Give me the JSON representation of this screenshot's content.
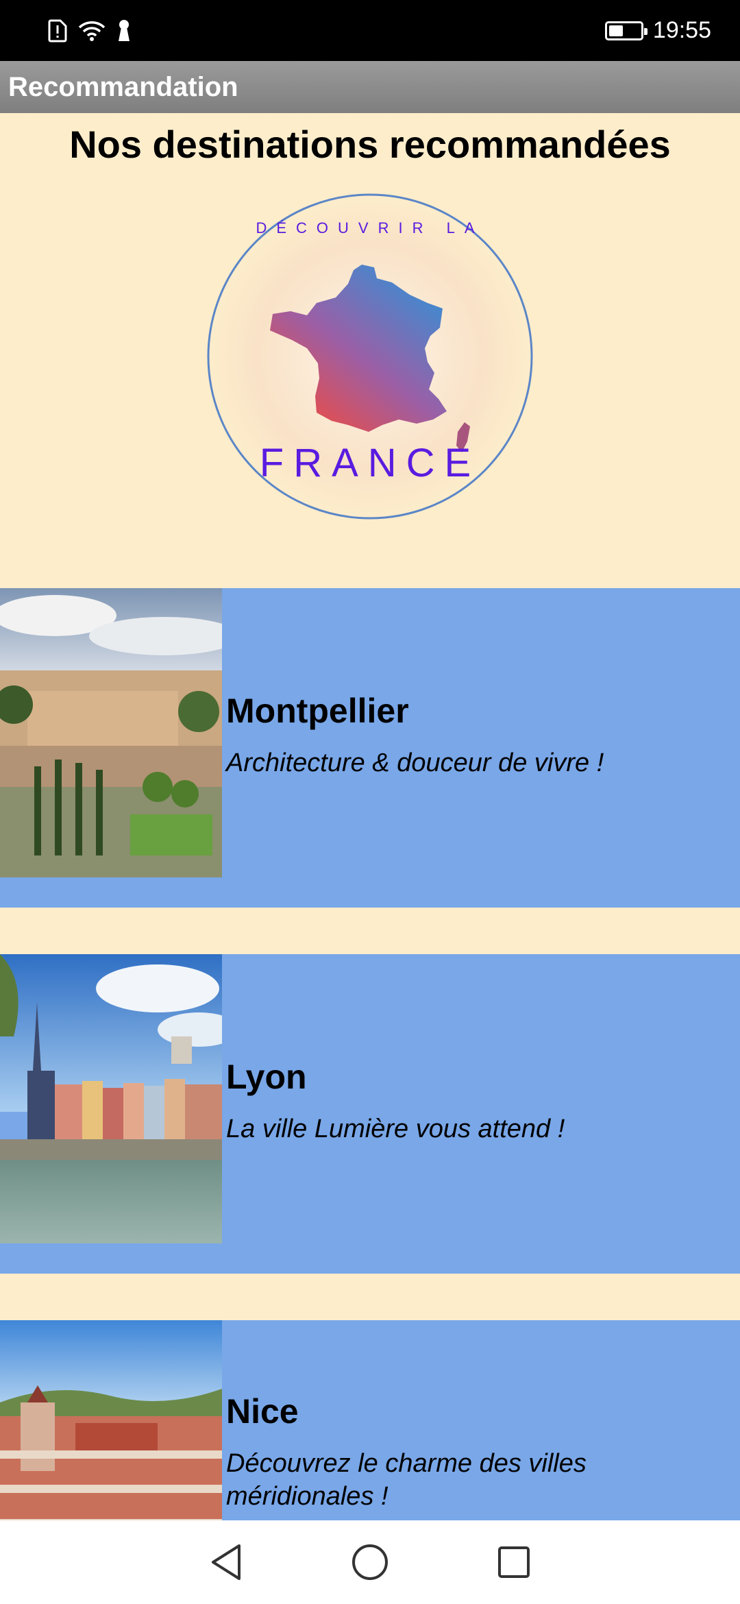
{
  "status_bar": {
    "time": "19:55",
    "battery_level": 0.45,
    "icons": [
      "sim-alert-icon",
      "wifi-icon",
      "lock-icon",
      "battery-icon"
    ]
  },
  "action_bar": {
    "title": "Recommandation"
  },
  "page": {
    "title": "Nos destinations recommandées"
  },
  "logo": {
    "top_text": "DÉCOUVRIR LA",
    "bottom_text": "FRANCE",
    "text_color": "#5A1BE0",
    "ring_color": "#5B86C7"
  },
  "destinations": [
    {
      "name": "Montpellier",
      "description": "Architecture & douceur de vivre !"
    },
    {
      "name": "Lyon",
      "description": "La ville Lumière vous attend !"
    },
    {
      "name": "Nice",
      "description": "Découvrez le charme des villes méridionales !"
    }
  ],
  "nav_bar": {
    "buttons": [
      "back-icon",
      "home-icon",
      "recents-icon"
    ]
  },
  "colors": {
    "background": "#FDEDCB",
    "card": "#79A7E8",
    "status_bar": "#000000",
    "action_bar": "#8C8C8C"
  }
}
